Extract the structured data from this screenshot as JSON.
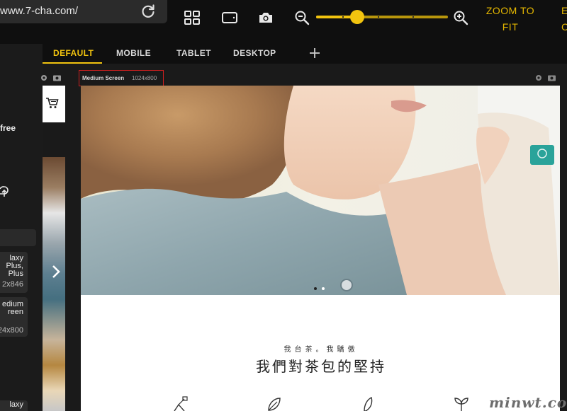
{
  "browser": {
    "url": "www.7-cha.com/"
  },
  "toolbar": {
    "zoom_to_fit": "ZOOM TO FIT",
    "edge_letters": [
      "E",
      "C"
    ],
    "zoom_level": 0.31
  },
  "tabs": [
    {
      "label": "DEFAULT",
      "active": true
    },
    {
      "label": "MOBILE",
      "active": false
    },
    {
      "label": "TABLET",
      "active": false
    },
    {
      "label": "DESKTOP",
      "active": false
    }
  ],
  "sidebar": {
    "free_text": "free",
    "device_boxes": [
      {
        "lines": [
          "laxy",
          "Plus,",
          "Plus"
        ],
        "size": "2x846"
      },
      {
        "lines": [
          "edium",
          "reen"
        ],
        "size": "24x800"
      }
    ],
    "bottom_text": "laxy"
  },
  "preview": {
    "screen_name": "Medium Screen",
    "screen_size": "1024x800"
  },
  "site": {
    "subtitle": "我台茶。我驕傲",
    "title": "我們對茶包的堅持"
  },
  "watermark": "minwt.com",
  "colors": {
    "accent": "#f2c40f",
    "highlight_border": "#cc1f1f"
  }
}
